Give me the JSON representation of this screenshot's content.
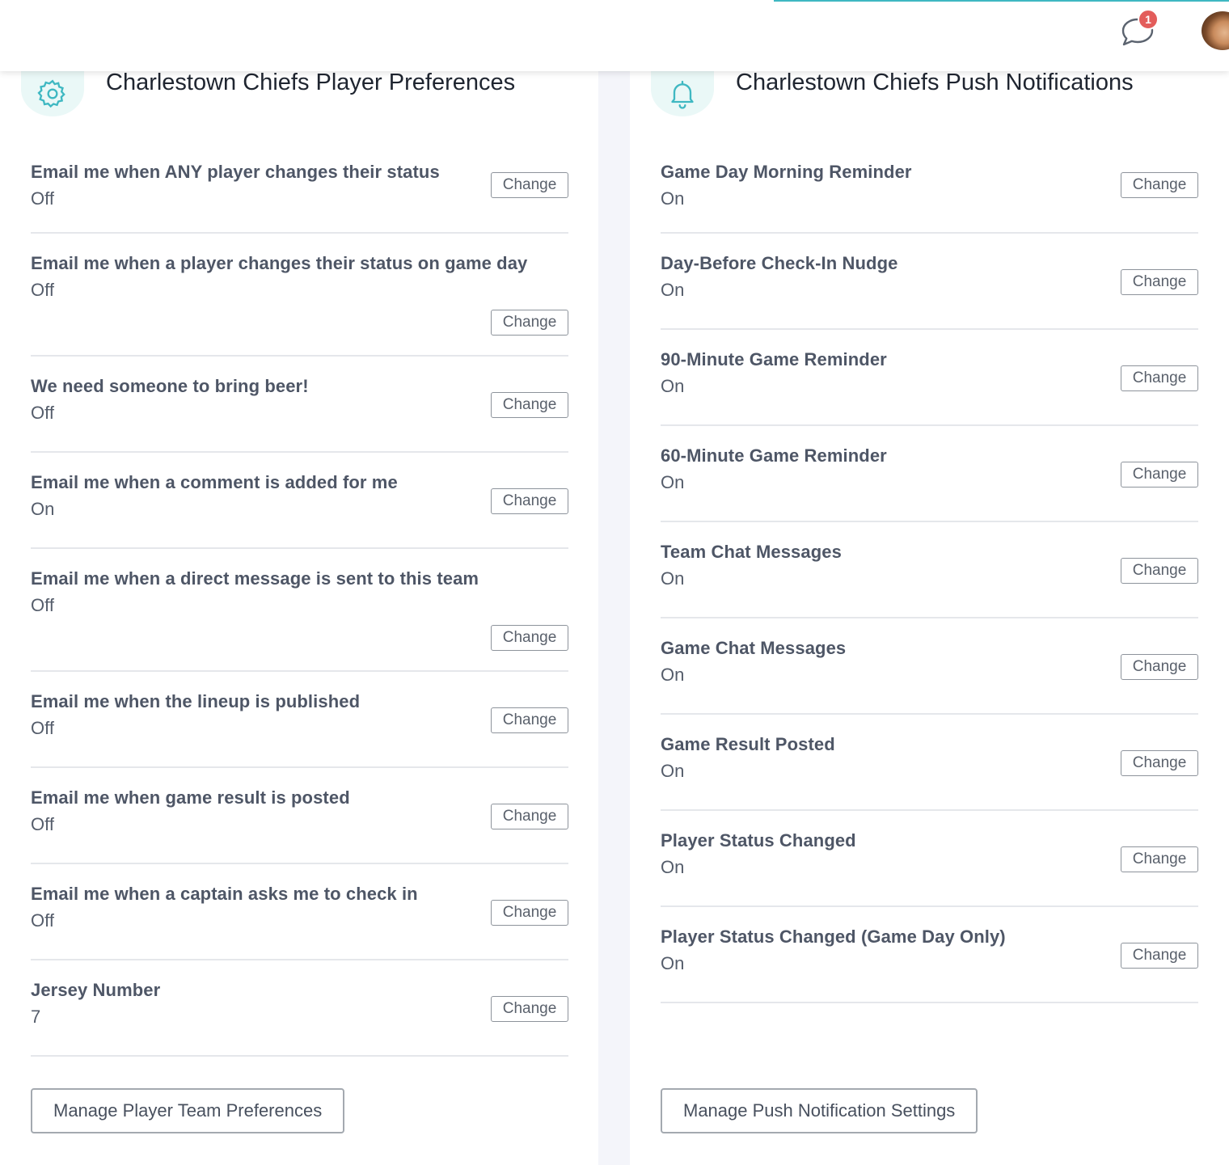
{
  "header": {
    "chat_badge_count": "1"
  },
  "left_panel": {
    "title": "Charlestown Chiefs Player Preferences",
    "icon": "gear-icon",
    "rows": [
      {
        "label": "Email me when ANY player changes their status",
        "value": "Off",
        "button": "Change"
      },
      {
        "label": "Email me when a player changes their status on game day",
        "value": "Off",
        "button": "Change"
      },
      {
        "label": "We need someone to bring beer!",
        "value": "Off",
        "button": "Change"
      },
      {
        "label": "Email me when a comment is added for me",
        "value": "On",
        "button": "Change"
      },
      {
        "label": "Email me when a direct message is sent to this team",
        "value": "Off",
        "button": "Change"
      },
      {
        "label": "Email me when the lineup is published",
        "value": "Off",
        "button": "Change"
      },
      {
        "label": "Email me when game result is posted",
        "value": "Off",
        "button": "Change"
      },
      {
        "label": "Email me when a captain asks me to check in",
        "value": "Off",
        "button": "Change"
      },
      {
        "label": "Jersey Number",
        "value": "7",
        "button": "Change"
      }
    ],
    "manage_button": "Manage Player Team Preferences"
  },
  "right_panel": {
    "title": "Charlestown Chiefs Push Notifications",
    "icon": "bell-icon",
    "rows": [
      {
        "label": "Game Day Morning Reminder",
        "value": "On",
        "button": "Change"
      },
      {
        "label": "Day-Before Check-In Nudge",
        "value": "On",
        "button": "Change"
      },
      {
        "label": "90-Minute Game Reminder",
        "value": "On",
        "button": "Change"
      },
      {
        "label": "60-Minute Game Reminder",
        "value": "On",
        "button": "Change"
      },
      {
        "label": "Team Chat Messages",
        "value": "On",
        "button": "Change"
      },
      {
        "label": "Game Chat Messages",
        "value": "On",
        "button": "Change"
      },
      {
        "label": "Game Result Posted",
        "value": "On",
        "button": "Change"
      },
      {
        "label": "Player Status Changed",
        "value": "On",
        "button": "Change"
      },
      {
        "label": "Player Status Changed (Game Day Only)",
        "value": "On",
        "button": "Change"
      }
    ],
    "manage_button": "Manage Push Notification Settings"
  },
  "colors": {
    "accent": "#3fb8c2",
    "badge": "#e35d5b",
    "icon_bg": "#eaf8f7"
  }
}
